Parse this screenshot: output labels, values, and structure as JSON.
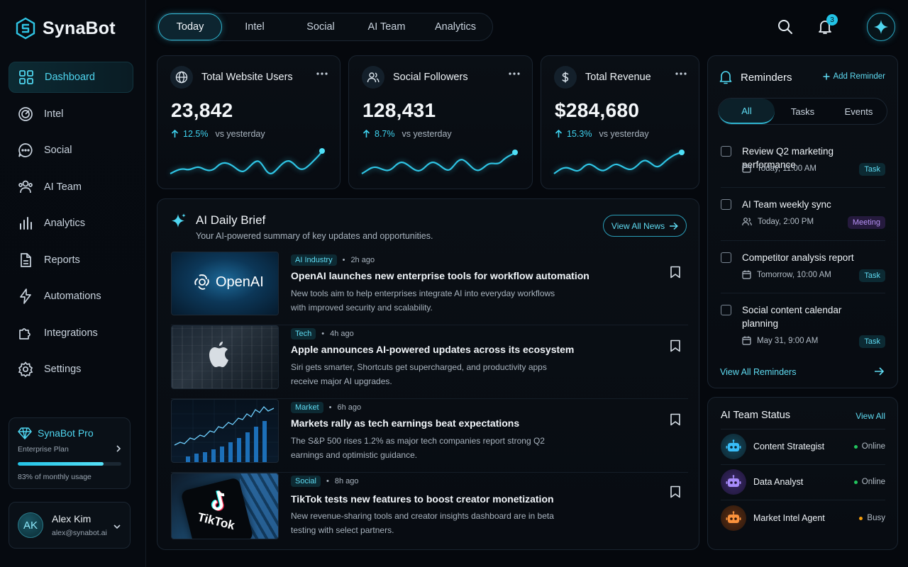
{
  "brand": {
    "name": "SynaBot"
  },
  "sidebar": {
    "items": [
      {
        "label": "Dashboard",
        "icon": "grid-icon",
        "active": true
      },
      {
        "label": "Intel",
        "icon": "radar-icon"
      },
      {
        "label": "Social",
        "icon": "chat-bubble-icon"
      },
      {
        "label": "AI Team",
        "icon": "team-icon"
      },
      {
        "label": "Analytics",
        "icon": "bar-chart-icon"
      },
      {
        "label": "Reports",
        "icon": "document-icon"
      },
      {
        "label": "Automations",
        "icon": "lightning-icon"
      },
      {
        "label": "Integrations",
        "icon": "puzzle-icon"
      },
      {
        "label": "Settings",
        "icon": "gear-icon"
      }
    ],
    "pro": {
      "title": "SynaBot Pro",
      "plan": "Enterprise Plan",
      "usage_label": "83% of monthly usage",
      "usage": 0.83
    },
    "user": {
      "initials": "AK",
      "name": "Alex Kim",
      "email": "alex@synabot.ai"
    }
  },
  "topnav": {
    "tabs": [
      {
        "label": "Today",
        "active": true
      },
      {
        "label": "Intel"
      },
      {
        "label": "Social"
      },
      {
        "label": "AI Team"
      },
      {
        "label": "Analytics"
      }
    ],
    "notification_count": "3"
  },
  "stats": [
    {
      "title": "Total Website Users",
      "value": "23,842",
      "change": "12.5%",
      "compare": "vs yesterday",
      "icon": "globe-icon"
    },
    {
      "title": "Social Followers",
      "value": "128,431",
      "change": "8.7%",
      "compare": "vs yesterday",
      "icon": "users-icon"
    },
    {
      "title": "Total Revenue",
      "value": "$284,680",
      "change": "15.3%",
      "compare": "vs yesterday",
      "icon": "dollar-icon"
    }
  ],
  "brief": {
    "title": "AI Daily Brief",
    "subtitle": "Your AI-powered summary of key updates and opportunities.",
    "view_all": "View All News",
    "news": [
      {
        "tag": "AI Industry",
        "time": "2h ago",
        "title": "OpenAI launches new enterprise tools for workflow automation",
        "desc": "New tools aim to help enterprises integrate AI into everyday workflows with improved security and scalability.",
        "thumb_text": "OpenAI"
      },
      {
        "tag": "Tech",
        "time": "4h ago",
        "title": "Apple announces AI-powered updates across its ecosystem",
        "desc": "Siri gets smarter, Shortcuts get supercharged, and productivity apps receive major AI upgrades."
      },
      {
        "tag": "Market",
        "time": "6h ago",
        "title": "Markets rally as tech earnings beat expectations",
        "desc": "The S&P 500 rises 1.2% as major tech companies report strong Q2 earnings and optimistic guidance."
      },
      {
        "tag": "Social",
        "time": "8h ago",
        "title": "TikTok tests new features to boost creator monetization",
        "desc": "New revenue-sharing tools and creator insights dashboard are in beta testing with select partners.",
        "thumb_text": "TikTok"
      }
    ]
  },
  "reminders": {
    "title": "Reminders",
    "add_label": "Add Reminder",
    "tabs": [
      {
        "label": "All",
        "active": true
      },
      {
        "label": "Tasks"
      },
      {
        "label": "Events"
      }
    ],
    "items": [
      {
        "title": "Review Q2 marketing performance",
        "time": "Today, 11:00 AM",
        "badge": "Task",
        "icon": "calendar-icon"
      },
      {
        "title": "AI Team weekly sync",
        "time": "Today, 2:00 PM",
        "badge": "Meeting",
        "icon": "people-icon"
      },
      {
        "title": "Competitor analysis report",
        "time": "Tomorrow, 10:00 AM",
        "badge": "Task",
        "icon": "calendar-icon"
      },
      {
        "title": "Social content calendar planning",
        "time": "May 31, 9:00 AM",
        "badge": "Task",
        "icon": "calendar-icon"
      }
    ],
    "view_all": "View All Reminders"
  },
  "team": {
    "title": "AI Team Status",
    "view_all": "View All",
    "agents": [
      {
        "name": "Content Strategist",
        "status": "Online",
        "color": "#22c55e",
        "avatar_color": "#38bdf8"
      },
      {
        "name": "Data Analyst",
        "status": "Online",
        "color": "#22c55e",
        "avatar_color": "#a78bfa"
      },
      {
        "name": "Market Intel Agent",
        "status": "Busy",
        "color": "#f59e0b",
        "avatar_color": "#fb923c"
      }
    ]
  },
  "colors": {
    "accent": "#3fd3f0",
    "background": "#05080d",
    "card": "#0a0f15"
  }
}
